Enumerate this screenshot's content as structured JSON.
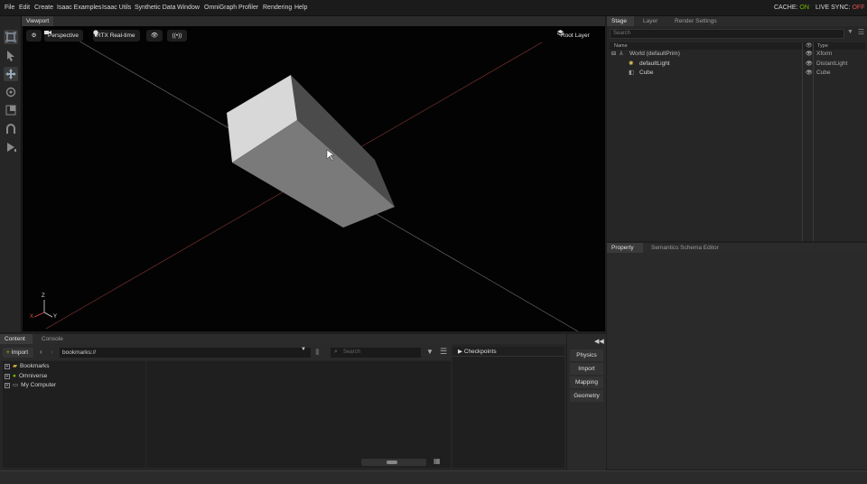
{
  "menubar": {
    "items": [
      "File",
      "Edit",
      "Create",
      "Isaac Examples",
      "Isaac Utils",
      "Synthetic Data",
      "Window",
      "OmniGraph",
      "Profiler",
      "Rendering",
      "Help"
    ],
    "cache_label": "CACHE:",
    "cache_value": "ON",
    "live_sync_label": "LIVE SYNC:",
    "live_sync_value": "OFF"
  },
  "viewport": {
    "tab": "Viewport",
    "camera_label": "Perspective",
    "renderer_label": "RTX Real-time",
    "layer_label": "Root Layer",
    "axis": {
      "z": "Z",
      "x": "X",
      "y": "Y"
    }
  },
  "stage": {
    "tabs": [
      "Stage",
      "Layer",
      "Render Settings"
    ],
    "search_placeholder": "Search",
    "columns": {
      "name": "Name",
      "type": "Type"
    },
    "rows": [
      {
        "name": "World (defaultPrim)",
        "type": "Xform"
      },
      {
        "name": "defaultLight",
        "type": "DistantLight"
      },
      {
        "name": "Cube",
        "type": "Cube"
      }
    ]
  },
  "property": {
    "tabs": [
      "Property",
      "Semantics Schema Editor"
    ]
  },
  "content": {
    "tabs": [
      "Content",
      "Console"
    ],
    "import_label": "Import",
    "path": "bookmarks://",
    "search_placeholder": "Search",
    "tree": [
      "Bookmarks",
      "Omniverse",
      "My Computer"
    ],
    "checkpoints_label": "Checkpoints"
  },
  "side_buttons": [
    "Physics",
    "Import",
    "Mapping",
    "Geometry"
  ],
  "colors": {
    "accent_on": "#76b900",
    "accent_off": "#e05050",
    "viewport_bg": "#030303"
  },
  "icons": [
    "select-icon",
    "arrow-icon",
    "move-icon",
    "rotate-icon",
    "scale-icon",
    "snap-icon",
    "play-icon",
    "gear-icon",
    "camera-icon",
    "light-bulb-icon",
    "eye-icon",
    "broadcast-icon",
    "layers-icon",
    "filter-icon",
    "menu-icon",
    "folder-icon",
    "globe-icon",
    "monitor-icon",
    "bookmark-icon",
    "grid-icon",
    "collapse-icon"
  ]
}
